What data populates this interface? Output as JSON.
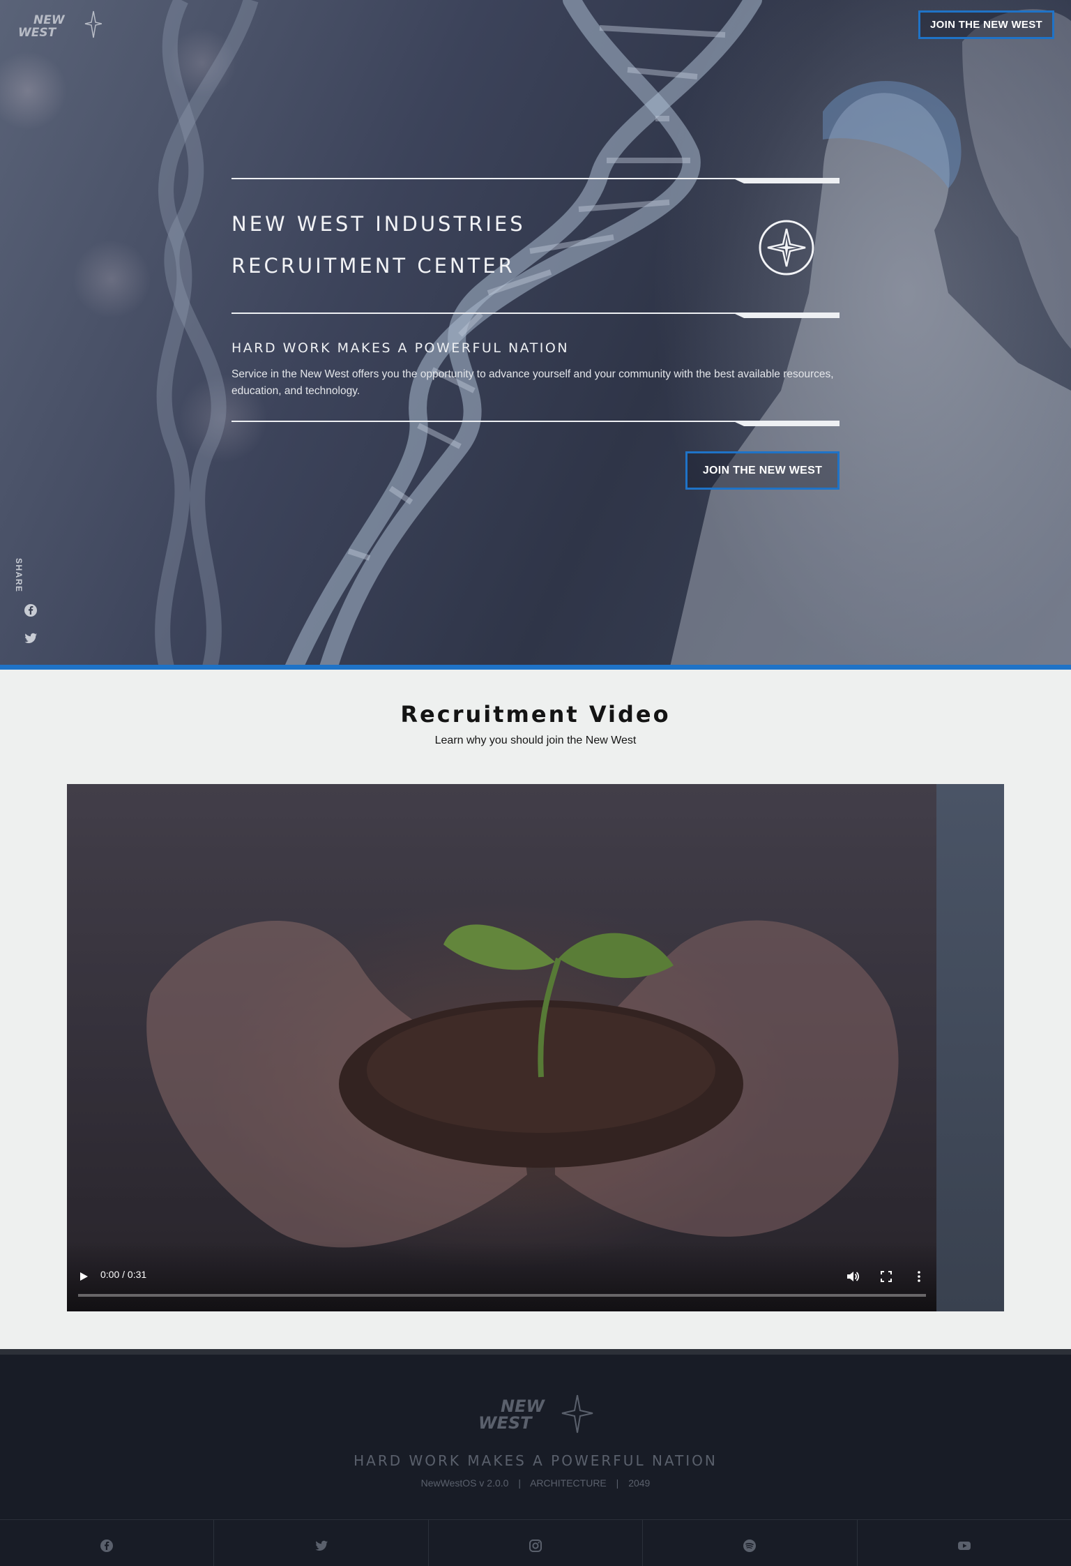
{
  "header": {
    "cta_label": "JOIN THE NEW WEST",
    "logo_text_line1": "NEW",
    "logo_text_line2": "WEST"
  },
  "hero": {
    "title_line1": "NEW WEST INDUSTRIES",
    "title_line2": "RECRUITMENT CENTER",
    "subheading": "HARD WORK MAKES A POWERFUL NATION",
    "description": "Service in the New West offers you the opportunity to advance yourself and your community with the best available resources, education, and technology.",
    "cta_label": "JOIN THE NEW WEST",
    "emblem_icon": "four-point-star-emblem-icon"
  },
  "share": {
    "label": "SHARE",
    "icons": [
      "facebook-icon",
      "twitter-icon"
    ]
  },
  "video_section": {
    "title": "Recruitment Video",
    "subtitle": "Learn why you should join the New West",
    "player": {
      "time": "0:00 / 0:31",
      "progress": 0,
      "controls": [
        "play-icon",
        "volume-icon",
        "fullscreen-icon",
        "more-options-icon"
      ]
    }
  },
  "footer": {
    "logo_text_line1": "NEW",
    "logo_text_line2": "WEST",
    "tagline": "HARD WORK MAKES A POWERFUL NATION",
    "version": "NewWestOS v 2.0.0",
    "separator": "|",
    "section": "ARCHITECTURE",
    "year": "2049",
    "social": [
      "facebook-icon",
      "twitter-icon",
      "instagram-icon",
      "spotify-icon",
      "youtube-icon"
    ]
  },
  "colors": {
    "accent": "#1f73c7",
    "footer_bg": "#181c26",
    "page_bg": "#eef0ef",
    "footer_text": "#5a606c"
  }
}
